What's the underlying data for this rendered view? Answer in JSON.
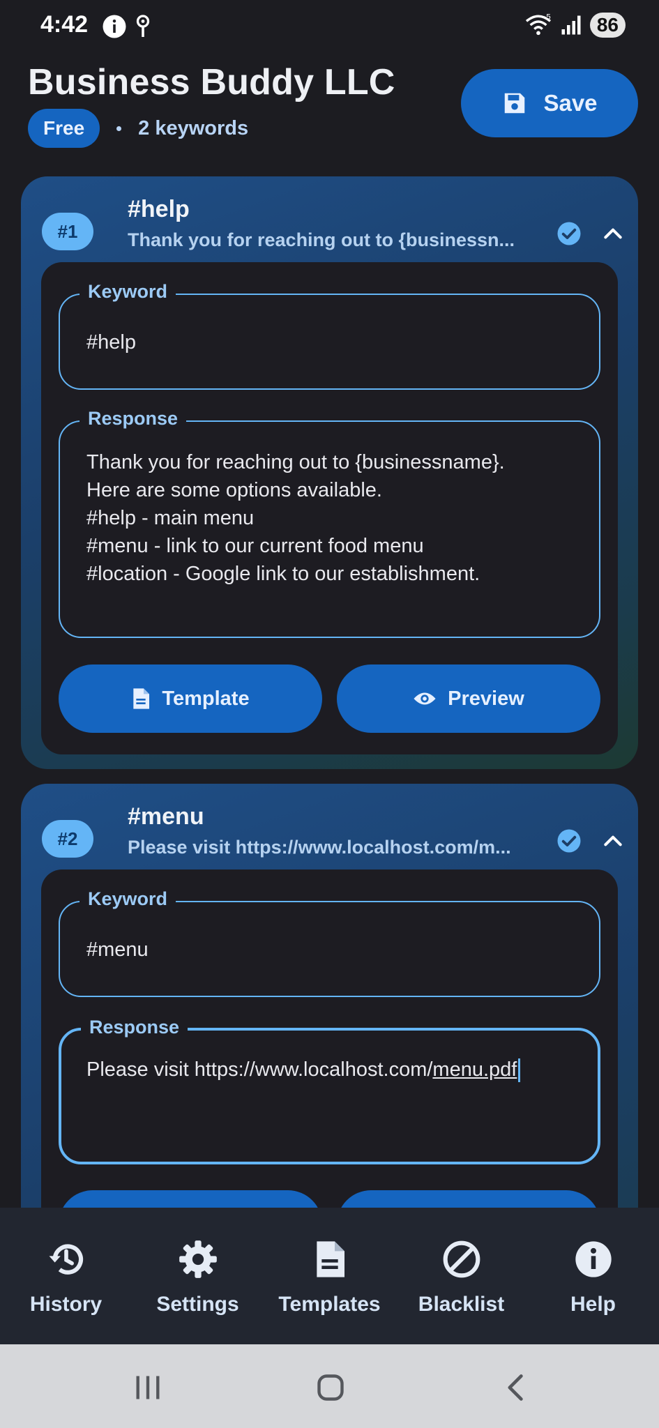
{
  "status_bar": {
    "time": "4:42",
    "network": "5",
    "battery": "86",
    "left_icons": [
      "info-icon",
      "location-pin-icon"
    ],
    "right_icons": [
      "wifi-icon",
      "signal-icon",
      "battery-icon"
    ]
  },
  "header": {
    "title": "Business Buddy LLC",
    "plan_badge": "Free",
    "keyword_count": "2 keywords",
    "save_label": "Save",
    "save_icon": "floppy-disk-icon"
  },
  "cards": [
    {
      "number": "#1",
      "title": "#help",
      "subtitle": "Thank you for reaching out to {businessn...",
      "keyword_label": "Keyword",
      "keyword_value": "#help",
      "response_label": "Response",
      "response_value": "Thank you for reaching out to {businessname}.\nHere are some options available.\n#help - main menu\n#menu - link to our current food menu\n#location - Google link to our establishment.",
      "template_label": "Template",
      "preview_label": "Preview"
    },
    {
      "number": "#2",
      "title": "#menu",
      "subtitle": "Please visit https://www.localhost.com/m...",
      "keyword_label": "Keyword",
      "keyword_value": "#menu",
      "response_label": "Response",
      "response_value_prefix": "Please visit https://www.localhost.com/",
      "response_value_underlined": "menu.pdf"
    }
  ],
  "bottom_nav": [
    {
      "label": "History",
      "icon": "history-icon"
    },
    {
      "label": "Settings",
      "icon": "gear-icon"
    },
    {
      "label": "Templates",
      "icon": "document-icon"
    },
    {
      "label": "Blacklist",
      "icon": "block-icon"
    },
    {
      "label": "Help",
      "icon": "info-icon"
    }
  ],
  "colors": {
    "background": "#1c1c21",
    "accent": "#1565c0",
    "accent_light": "#64b5f6",
    "nav_background": "#222630"
  }
}
